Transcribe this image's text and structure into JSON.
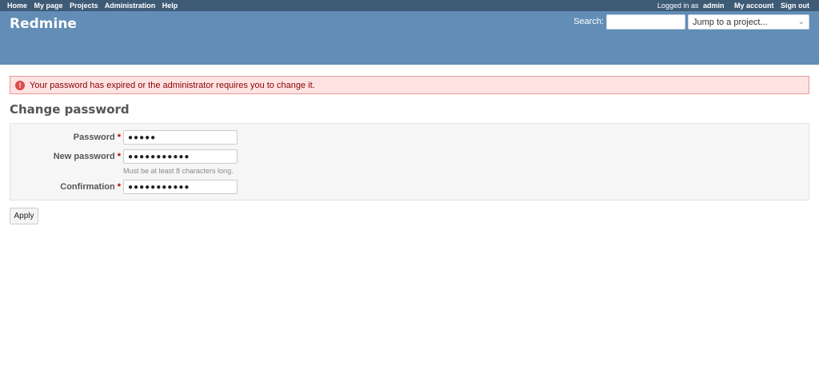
{
  "top_menu": {
    "left": [
      "Home",
      "My page",
      "Projects",
      "Administration",
      "Help"
    ],
    "logged_in_prefix": "Logged in as",
    "user": "admin",
    "my_account": "My account",
    "sign_out": "Sign out"
  },
  "header": {
    "title": "Redmine",
    "search_label": "Search:",
    "search_value": "",
    "jump_label": "Jump to a project..."
  },
  "flash": {
    "message": "Your password has expired or the administrator requires you to change it."
  },
  "page": {
    "title": "Change password"
  },
  "form": {
    "password_label": "Password",
    "password_value": "●●●●●",
    "new_password_label": "New password",
    "new_password_value": "●●●●●●●●●●●",
    "new_password_hint": "Must be at least 8 characters long.",
    "confirmation_label": "Confirmation",
    "confirmation_value": "●●●●●●●●●●●",
    "required_mark": "*",
    "apply_label": "Apply"
  }
}
